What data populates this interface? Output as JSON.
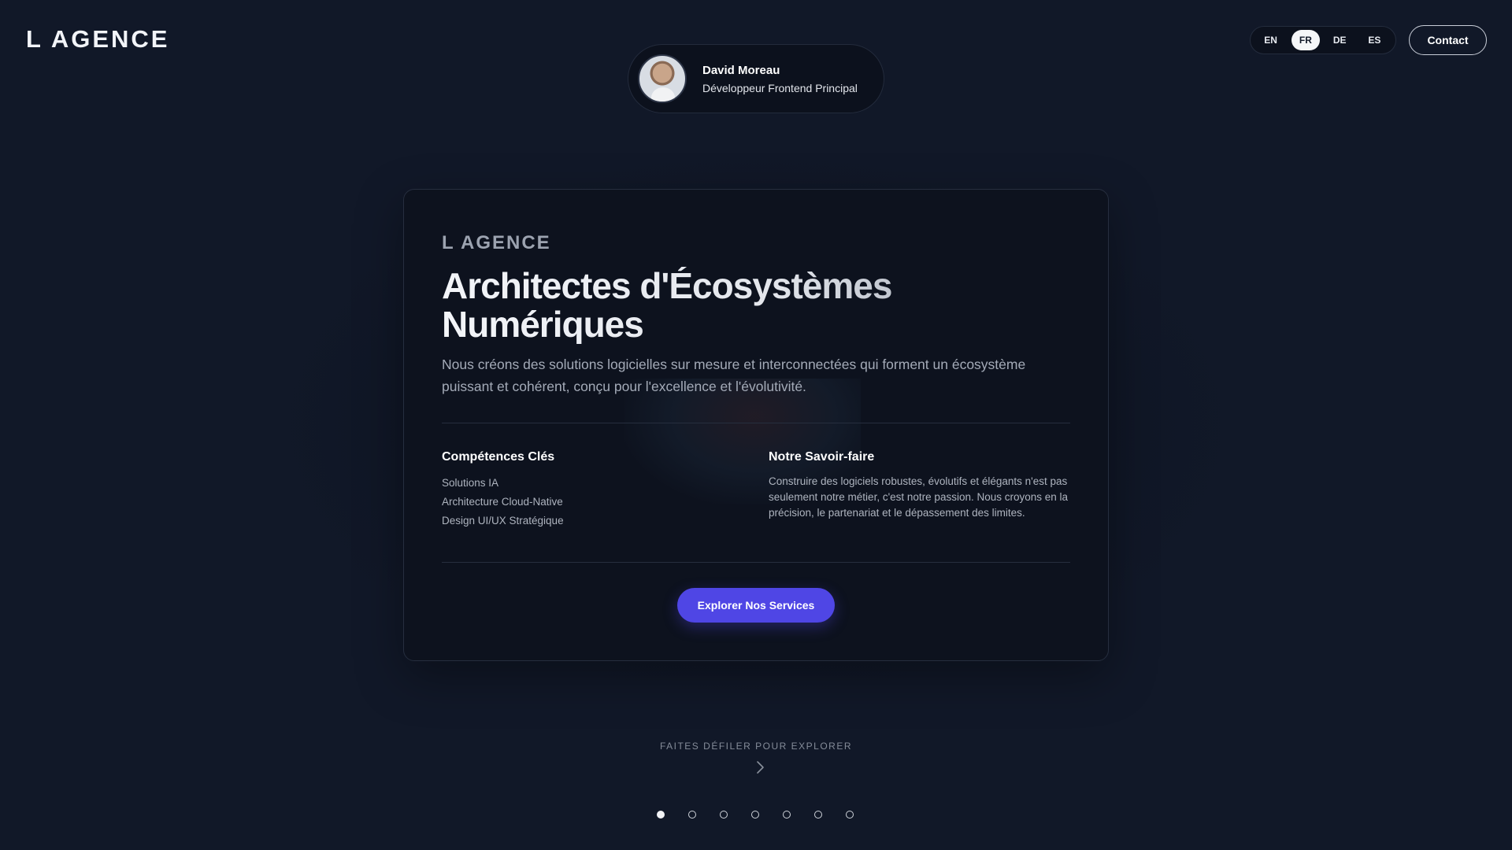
{
  "header": {
    "brand": "L AGENCE",
    "profile": {
      "name": "David Moreau",
      "role": "Développeur Frontend Principal"
    },
    "languages": [
      {
        "code": "EN",
        "active": false
      },
      {
        "code": "FR",
        "active": true
      },
      {
        "code": "DE",
        "active": false
      },
      {
        "code": "ES",
        "active": false
      }
    ],
    "contact_label": "Contact"
  },
  "card": {
    "eyebrow": "L AGENCE",
    "title_line1": "Architectes d'Écosystèmes",
    "title_line2": "Numériques",
    "description": "Nous créons des solutions logicielles sur mesure et interconnectées qui forment un écosystème puissant et cohérent, conçu pour l'excellence et l'évolutivité.",
    "skills": {
      "title": "Compétences Clés",
      "items": [
        "Solutions IA",
        "Architecture Cloud-Native",
        "Design UI/UX Stratégique"
      ]
    },
    "savoir_faire": {
      "title": "Notre Savoir-faire",
      "text": "Construire des logiciels robustes, évolutifs et élégants n'est pas seulement notre métier, c'est notre passion. Nous croyons en la précision, le partenariat et le dépassement des limites."
    },
    "cta_label": "Explorer Nos Services"
  },
  "scroll_hint": "FAITES DÉFILER POUR EXPLORER",
  "pagination": {
    "total": 7,
    "current": 1
  },
  "colors": {
    "background": "#111828",
    "card": "#0d121e",
    "accent": "#4f46e5"
  }
}
